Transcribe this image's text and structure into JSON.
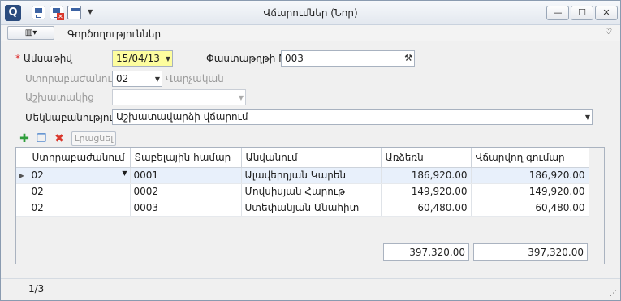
{
  "window": {
    "title": "Վճարումներ (Նոր)",
    "app_icon_letter": "Q"
  },
  "window_controls": {
    "minimize": "—",
    "maximize": "☐",
    "close": "✕"
  },
  "menu": {
    "button_label": "▥▾",
    "label": "Գործողություններ",
    "collapse": "♡"
  },
  "form": {
    "date_label": "Ամսաթիվ",
    "required_mark": "*",
    "date_value": "15/04/13",
    "doc_num_label": "Փաստաթղթի N",
    "doc_num_value": "003",
    "subdivision_label": "Ստորաբաժանում",
    "subdivision_value": "02",
    "subdivision_desc": "Վարչական",
    "employee_label": "Աշխատակից",
    "employee_value": "",
    "comment_label": "Մեկնաբանություն",
    "comment_value": "Աշխատավարձի վճարում"
  },
  "toolbar": {
    "add_icon": "✚",
    "copy_icon": "❐",
    "delete_icon": "✖",
    "refresh_label": "Լրացնել"
  },
  "table": {
    "columns": [
      "Ստորաբաժանում",
      "Տաբելային համար",
      "Անվանում",
      "Առձեռն",
      "Վճարվող գումար"
    ],
    "rows": [
      [
        "02",
        "0001",
        "Ալավերդյան Կարեն",
        "186,920.00",
        "186,920.00"
      ],
      [
        "02",
        "0002",
        "Մովսիսյան Հարութ",
        "149,920.00",
        "149,920.00"
      ],
      [
        "02",
        "0003",
        "Ստեփանյան Անահիտ",
        "60,480.00",
        "60,480.00"
      ]
    ],
    "totals": [
      "397,320.00",
      "397,320.00"
    ]
  },
  "status": {
    "record": "1/3"
  },
  "colors": {
    "accent": "#2b4c7e",
    "date_highlight": "#fdfd9e",
    "required": "#d22",
    "add_icon": "#2e9e3b",
    "delete_icon": "#d9372b"
  }
}
